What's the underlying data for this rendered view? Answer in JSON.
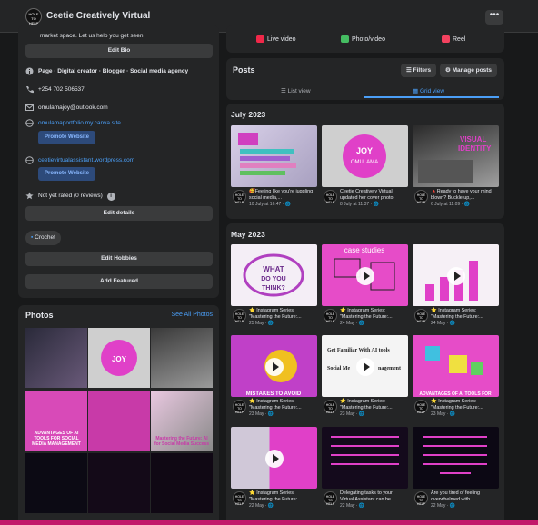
{
  "header": {
    "title": "Ceetie Creatively Virtual",
    "more_label": "•••",
    "avatar_text": "HOLE TO HELP"
  },
  "intro": {
    "bio_tail": "market space. Let us help you get seen",
    "edit_bio": "Edit Bio",
    "page_info": "Page · Digital creator · Blogger · Social media agency",
    "phone": "+254 702 506537",
    "email": "omulamajoy@outlook.com",
    "website1": "omulamaportfolio.my.canva.site",
    "promote1": "Promote Website",
    "website2": "ceetievirtualassistant.wordpress.com",
    "promote2": "Promote Website",
    "rating": "Not yet rated (0 reviews)",
    "edit_details": "Edit details",
    "hobby": "Crochet",
    "edit_hobbies": "Edit Hobbies",
    "add_featured": "Add Featured"
  },
  "photos": {
    "title": "Photos",
    "see_all": "See All Photos",
    "tiles": [
      {
        "label": ""
      },
      {
        "label": ""
      },
      {
        "label": ""
      },
      {
        "label": "ADVANTAGES OF AI TOOLS FOR SOCIAL MEDIA MANAGEMENT"
      },
      {
        "label": ""
      },
      {
        "label": "Mastering the Future: AI for Social Media Success"
      },
      {
        "label": ""
      },
      {
        "label": ""
      },
      {
        "label": ""
      }
    ]
  },
  "create": {
    "live": "Live video",
    "photo": "Photo/video",
    "reel": "Reel"
  },
  "posts": {
    "title": "Posts",
    "filters": "Filters",
    "manage": "Manage posts",
    "list_view": "List view",
    "grid_view": "Grid view"
  },
  "july": {
    "month": "July 2023",
    "cards": [
      {
        "text": "🥰Feeling like you're juggling social media,...",
        "date": "10 July at 16:47 · 🌐"
      },
      {
        "text": "Ceetie Creatively Virtual updated her cover photo.",
        "date": "8 July at 11:37 · 🌐"
      },
      {
        "text": "🔺Ready to have your mind blown? Buckle up,...",
        "date": "6 July at 11:09 · 🌐"
      }
    ]
  },
  "may": {
    "month": "May 2023",
    "cards": [
      {
        "text": "⭐ Instagram Series: \"Mastering the Future:...",
        "date": "25 May · 🌐"
      },
      {
        "text": "⭐ Instagram Series: \"Mastering the Future:...",
        "date": "24 May · 🌐"
      },
      {
        "text": "⭐ Instagram Series: \"Mastering the Future:...",
        "date": "24 May · 🌐"
      },
      {
        "text": "⭐ Instagram Series: \"Mastering the Future:...",
        "date": "23 May · 🌐"
      },
      {
        "text": "⭐ Instagram Series: \"Mastering the Future:...",
        "date": "23 May · 🌐"
      },
      {
        "text": "⭐ Instagram Series: \"Mastering the Future:...",
        "date": "23 May · 🌐"
      },
      {
        "text": "⭐ Instagram Series: \"Mastering the Future:...",
        "date": "22 May · 🌐"
      },
      {
        "text": "Delegating tasks to your Virtual Assistant can be ...",
        "date": "22 May · 🌐"
      },
      {
        "text": "Are you tired of feeling overwhelmed with...",
        "date": "22 May · 🌐"
      }
    ]
  },
  "thumb_text": {
    "joy": "JOY OMULAMA",
    "what": "WHAT DO YOU THINK?",
    "case": "case studies",
    "visual": "VISUAL IDENTITY",
    "ai": "Get Familiar With AI tools for Social Media Management",
    "adv": "ADVANTAGES OF AI TOOLS FOR",
    "mistakes": "MISTAKES TO AVOID"
  },
  "colors": {
    "accent": "#4b9ff7",
    "pink": "#e040c8",
    "bg": "#18191a",
    "panel": "#242526"
  }
}
